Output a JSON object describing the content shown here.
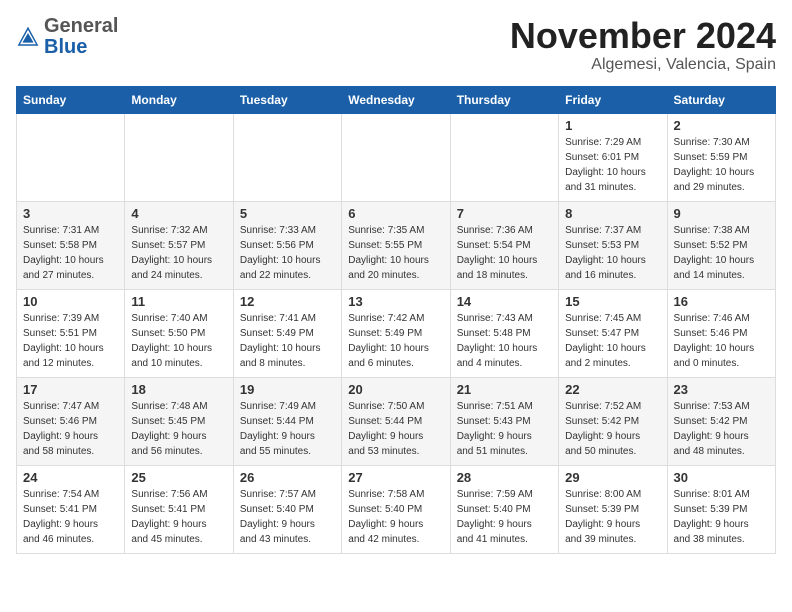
{
  "logo": {
    "general": "General",
    "blue": "Blue"
  },
  "title": {
    "month": "November 2024",
    "location": "Algemesi, Valencia, Spain"
  },
  "headers": [
    "Sunday",
    "Monday",
    "Tuesday",
    "Wednesday",
    "Thursday",
    "Friday",
    "Saturday"
  ],
  "weeks": [
    [
      {
        "day": "",
        "info": ""
      },
      {
        "day": "",
        "info": ""
      },
      {
        "day": "",
        "info": ""
      },
      {
        "day": "",
        "info": ""
      },
      {
        "day": "",
        "info": ""
      },
      {
        "day": "1",
        "info": "Sunrise: 7:29 AM\nSunset: 6:01 PM\nDaylight: 10 hours\nand 31 minutes."
      },
      {
        "day": "2",
        "info": "Sunrise: 7:30 AM\nSunset: 5:59 PM\nDaylight: 10 hours\nand 29 minutes."
      }
    ],
    [
      {
        "day": "3",
        "info": "Sunrise: 7:31 AM\nSunset: 5:58 PM\nDaylight: 10 hours\nand 27 minutes."
      },
      {
        "day": "4",
        "info": "Sunrise: 7:32 AM\nSunset: 5:57 PM\nDaylight: 10 hours\nand 24 minutes."
      },
      {
        "day": "5",
        "info": "Sunrise: 7:33 AM\nSunset: 5:56 PM\nDaylight: 10 hours\nand 22 minutes."
      },
      {
        "day": "6",
        "info": "Sunrise: 7:35 AM\nSunset: 5:55 PM\nDaylight: 10 hours\nand 20 minutes."
      },
      {
        "day": "7",
        "info": "Sunrise: 7:36 AM\nSunset: 5:54 PM\nDaylight: 10 hours\nand 18 minutes."
      },
      {
        "day": "8",
        "info": "Sunrise: 7:37 AM\nSunset: 5:53 PM\nDaylight: 10 hours\nand 16 minutes."
      },
      {
        "day": "9",
        "info": "Sunrise: 7:38 AM\nSunset: 5:52 PM\nDaylight: 10 hours\nand 14 minutes."
      }
    ],
    [
      {
        "day": "10",
        "info": "Sunrise: 7:39 AM\nSunset: 5:51 PM\nDaylight: 10 hours\nand 12 minutes."
      },
      {
        "day": "11",
        "info": "Sunrise: 7:40 AM\nSunset: 5:50 PM\nDaylight: 10 hours\nand 10 minutes."
      },
      {
        "day": "12",
        "info": "Sunrise: 7:41 AM\nSunset: 5:49 PM\nDaylight: 10 hours\nand 8 minutes."
      },
      {
        "day": "13",
        "info": "Sunrise: 7:42 AM\nSunset: 5:49 PM\nDaylight: 10 hours\nand 6 minutes."
      },
      {
        "day": "14",
        "info": "Sunrise: 7:43 AM\nSunset: 5:48 PM\nDaylight: 10 hours\nand 4 minutes."
      },
      {
        "day": "15",
        "info": "Sunrise: 7:45 AM\nSunset: 5:47 PM\nDaylight: 10 hours\nand 2 minutes."
      },
      {
        "day": "16",
        "info": "Sunrise: 7:46 AM\nSunset: 5:46 PM\nDaylight: 10 hours\nand 0 minutes."
      }
    ],
    [
      {
        "day": "17",
        "info": "Sunrise: 7:47 AM\nSunset: 5:46 PM\nDaylight: 9 hours\nand 58 minutes."
      },
      {
        "day": "18",
        "info": "Sunrise: 7:48 AM\nSunset: 5:45 PM\nDaylight: 9 hours\nand 56 minutes."
      },
      {
        "day": "19",
        "info": "Sunrise: 7:49 AM\nSunset: 5:44 PM\nDaylight: 9 hours\nand 55 minutes."
      },
      {
        "day": "20",
        "info": "Sunrise: 7:50 AM\nSunset: 5:44 PM\nDaylight: 9 hours\nand 53 minutes."
      },
      {
        "day": "21",
        "info": "Sunrise: 7:51 AM\nSunset: 5:43 PM\nDaylight: 9 hours\nand 51 minutes."
      },
      {
        "day": "22",
        "info": "Sunrise: 7:52 AM\nSunset: 5:42 PM\nDaylight: 9 hours\nand 50 minutes."
      },
      {
        "day": "23",
        "info": "Sunrise: 7:53 AM\nSunset: 5:42 PM\nDaylight: 9 hours\nand 48 minutes."
      }
    ],
    [
      {
        "day": "24",
        "info": "Sunrise: 7:54 AM\nSunset: 5:41 PM\nDaylight: 9 hours\nand 46 minutes."
      },
      {
        "day": "25",
        "info": "Sunrise: 7:56 AM\nSunset: 5:41 PM\nDaylight: 9 hours\nand 45 minutes."
      },
      {
        "day": "26",
        "info": "Sunrise: 7:57 AM\nSunset: 5:40 PM\nDaylight: 9 hours\nand 43 minutes."
      },
      {
        "day": "27",
        "info": "Sunrise: 7:58 AM\nSunset: 5:40 PM\nDaylight: 9 hours\nand 42 minutes."
      },
      {
        "day": "28",
        "info": "Sunrise: 7:59 AM\nSunset: 5:40 PM\nDaylight: 9 hours\nand 41 minutes."
      },
      {
        "day": "29",
        "info": "Sunrise: 8:00 AM\nSunset: 5:39 PM\nDaylight: 9 hours\nand 39 minutes."
      },
      {
        "day": "30",
        "info": "Sunrise: 8:01 AM\nSunset: 5:39 PM\nDaylight: 9 hours\nand 38 minutes."
      }
    ]
  ]
}
